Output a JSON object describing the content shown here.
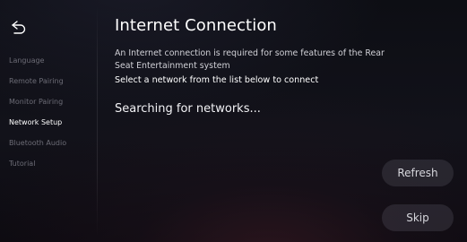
{
  "back_button": {
    "icon": "back-arrow-icon"
  },
  "sidebar": {
    "items": [
      {
        "label": "Language",
        "active": false
      },
      {
        "label": "Remote Pairing",
        "active": false
      },
      {
        "label": "Monitor Pairing",
        "active": false
      },
      {
        "label": "Network Setup",
        "active": true
      },
      {
        "label": "Bluetooth Audio",
        "active": false
      },
      {
        "label": "Tutorial",
        "active": false
      }
    ]
  },
  "main": {
    "title": "Internet Connection",
    "description": "An Internet connection is required for some features of the Rear Seat Entertainment system",
    "instruction": "Select a network from the list below to connect",
    "status": "Searching for networks..."
  },
  "buttons": {
    "refresh_label": "Refresh",
    "skip_label": "Skip"
  },
  "colors": {
    "background": "#0d0e14",
    "text_primary": "#ffffff",
    "text_inactive": "#6c6c76",
    "button_background": "#3a3a42"
  }
}
